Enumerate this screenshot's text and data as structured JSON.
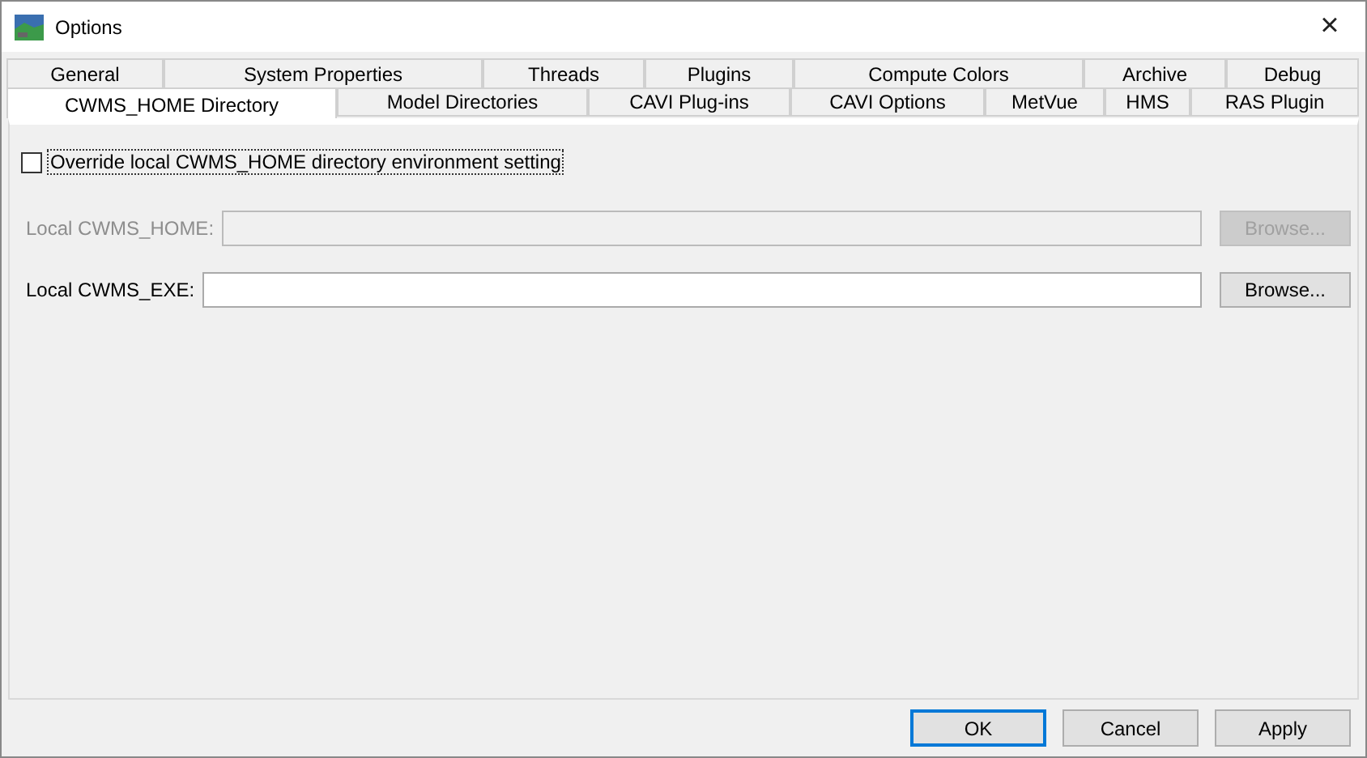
{
  "window": {
    "title": "Options",
    "close": "×"
  },
  "tab_rows": [
    [
      {
        "label": "General",
        "selected": false
      },
      {
        "label": "System Properties",
        "selected": false
      },
      {
        "label": "Threads",
        "selected": false
      },
      {
        "label": "Plugins",
        "selected": false
      },
      {
        "label": "Compute Colors",
        "selected": false
      },
      {
        "label": "Archive",
        "selected": false
      },
      {
        "label": "Debug",
        "selected": false
      }
    ],
    [
      {
        "label": "CWMS_HOME Directory",
        "selected": true
      },
      {
        "label": "Model Directories",
        "selected": false
      },
      {
        "label": "CAVI Plug-ins",
        "selected": false
      },
      {
        "label": "CAVI Options",
        "selected": false
      },
      {
        "label": "MetVue",
        "selected": false
      },
      {
        "label": "HMS",
        "selected": false
      },
      {
        "label": "RAS Plugin",
        "selected": false
      }
    ]
  ],
  "override_checkbox": {
    "label": "Override local CWMS_HOME directory environment setting",
    "checked": false
  },
  "fields": [
    {
      "label": "Local CWMS_HOME:",
      "disabled": true,
      "button": "Browse..."
    },
    {
      "label": "Local CWMS_EXE:",
      "disabled": false,
      "button": "Browse..."
    }
  ],
  "buttons": [
    {
      "label": "OK",
      "default": true
    },
    {
      "label": "Cancel",
      "default": false
    },
    {
      "label": "Apply",
      "default": false
    }
  ]
}
